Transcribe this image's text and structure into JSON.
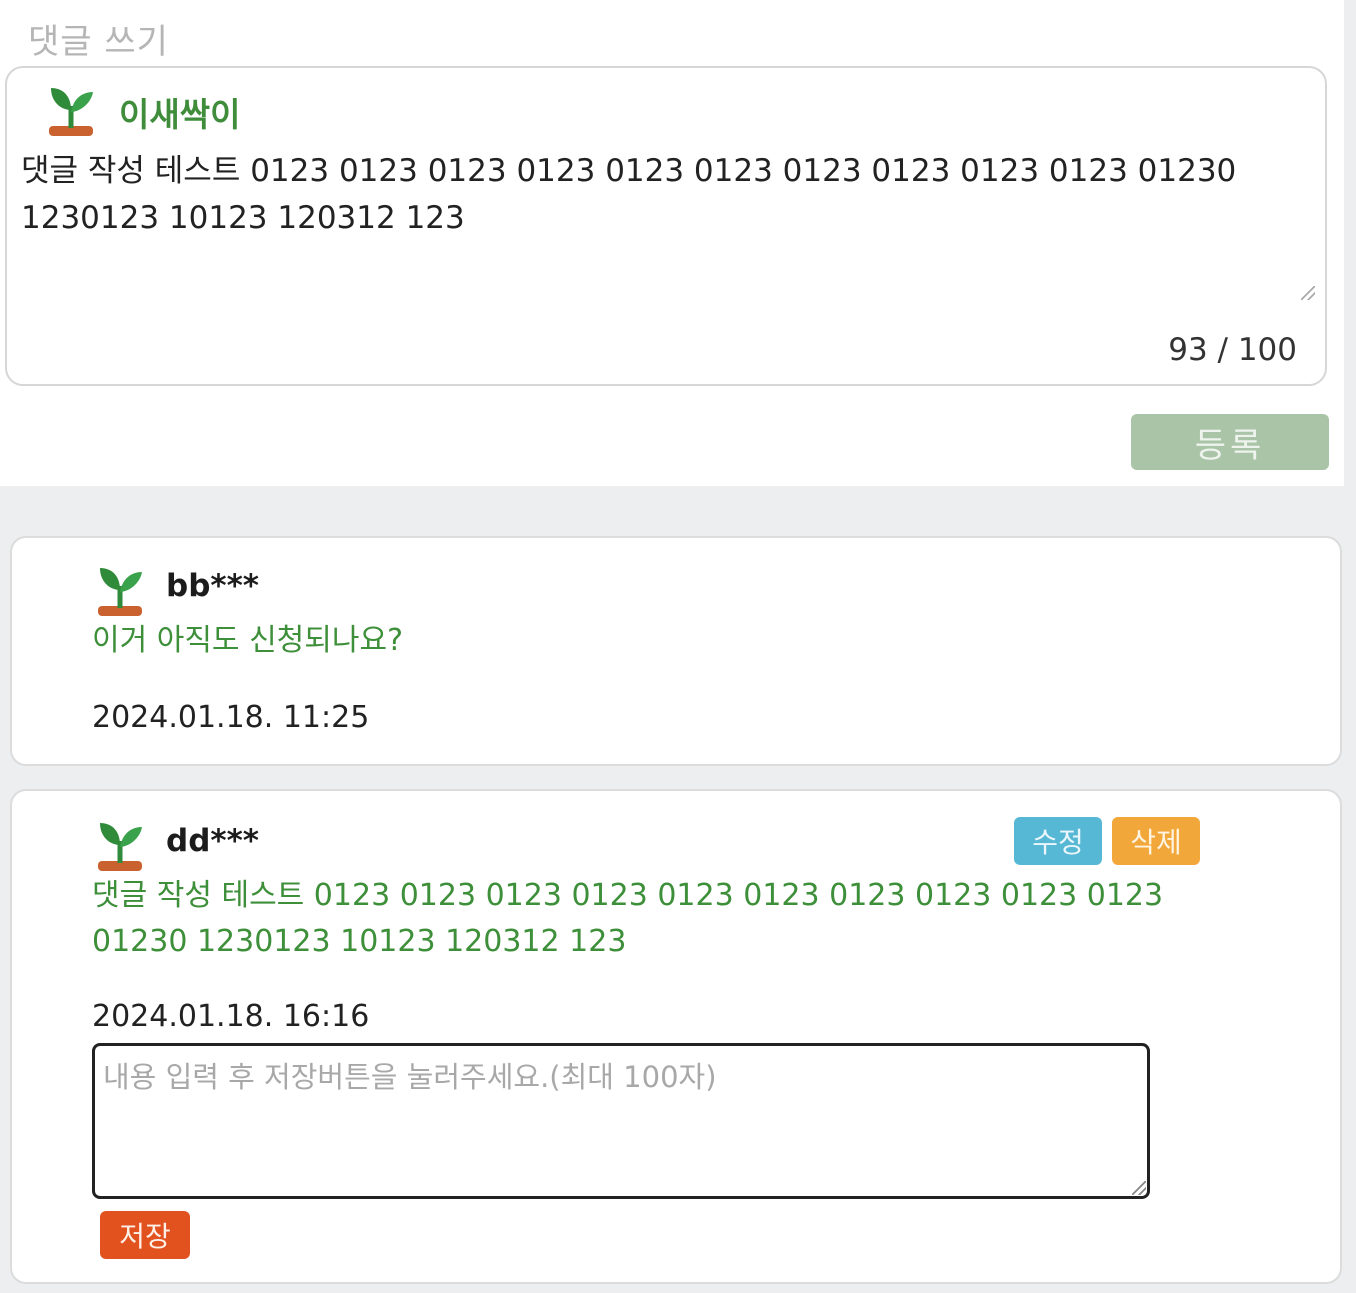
{
  "write": {
    "title": "댓글 쓰기",
    "username": "이새싹이",
    "text": "댓글 작성 테스트 0123 0123 0123 0123 0123 0123 0123 0123 0123 0123 01230 1230123 10123 120312 123",
    "counter": "93 / 100",
    "register_label": "등록"
  },
  "comments": [
    {
      "user": "bb***",
      "text": "이거 아직도 신청되나요?",
      "date": "2024.01.18. 11:25"
    },
    {
      "user": "dd***",
      "text_line1": "댓글 작성 테스트 0123 0123 0123 0123 0123 0123 0123 0123 0123 0123",
      "text_line2": "01230 1230123 10123 120312 123",
      "date": "2024.01.18. 16:16",
      "edit_label": "수정",
      "delete_label": "삭제",
      "edit_placeholder": "내용 입력 후 저장버튼을 눌러주세요.(최대 100자)",
      "save_label": "저장"
    }
  ],
  "icons": {
    "avatar": "sprout-icon"
  },
  "colors": {
    "username_green": "#3f8d3b",
    "register_button": "#a9c4a6",
    "edit_button": "#56b8d4",
    "delete_button": "#f2a73a",
    "save_button": "#e2521f"
  }
}
